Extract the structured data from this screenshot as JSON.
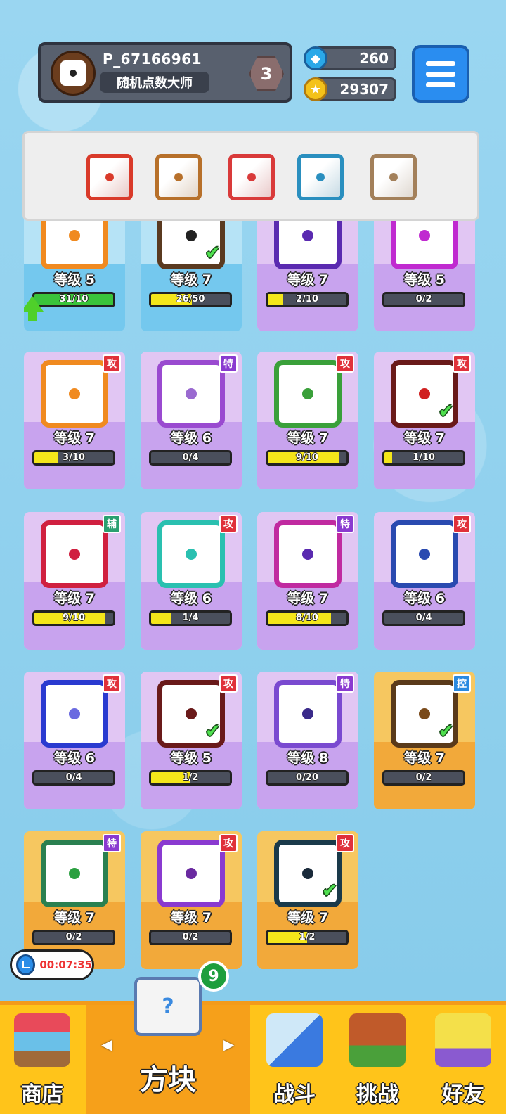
{
  "header": {
    "player_name": "P_67166961",
    "player_title": "随机点数大师",
    "rank": "3",
    "gems": "260",
    "gold": "29307"
  },
  "deck": {
    "slots": [
      {
        "name": "fire-dice-slot",
        "color": "#d93a2a"
      },
      {
        "name": "dragon-dice-slot",
        "color": "#b7702a"
      },
      {
        "name": "lightning-dice-slot",
        "color": "#d93a3a"
      },
      {
        "name": "vortex-dice-slot",
        "color": "#2a8fbf"
      },
      {
        "name": "mystery-dice-slot",
        "color": "#a3805a"
      }
    ]
  },
  "cards": [
    {
      "name": "card-sun",
      "theme": "blue",
      "border": "#f08a20",
      "pip": "#f08a20",
      "level": "等级 5",
      "progress": "31/10",
      "fill": 1.0,
      "fill_color": "green",
      "tag": "",
      "tag_color": "",
      "check": false,
      "upgrade": true
    },
    {
      "name": "card-mystery",
      "theme": "blue",
      "border": "#5a3a20",
      "pip": "#222222",
      "level": "等级 7",
      "progress": "26/50",
      "fill": 0.52,
      "fill_color": "yellow",
      "tag": "",
      "tag_color": "",
      "check": true,
      "upgrade": false
    },
    {
      "name": "card-sword",
      "theme": "purple",
      "border": "#5a2ab0",
      "pip": "#5a2ab0",
      "level": "等级 7",
      "progress": "2/10",
      "fill": 0.2,
      "fill_color": "yellow",
      "tag": "",
      "tag_color": "",
      "check": false,
      "upgrade": false
    },
    {
      "name": "card-pixel",
      "theme": "purple",
      "border": "#c02ad0",
      "pip": "#c02ad0",
      "level": "等级 5",
      "progress": "0/2",
      "fill": 0,
      "fill_color": "yellow",
      "tag": "",
      "tag_color": "",
      "check": false,
      "upgrade": false
    },
    {
      "name": "card-target",
      "theme": "purple",
      "border": "#f08a20",
      "pip": "#f08a20",
      "level": "等级 7",
      "progress": "3/10",
      "fill": 0.3,
      "fill_color": "yellow",
      "tag": "攻",
      "tag_color": "#e0313a",
      "check": false,
      "upgrade": false
    },
    {
      "name": "card-rainbow",
      "theme": "purple",
      "border": "#9a4ad0",
      "pip": "#9a6ad0",
      "level": "等级 6",
      "progress": "0/4",
      "fill": 0,
      "fill_color": "yellow",
      "tag": "特",
      "tag_color": "#8a3ad0",
      "check": false,
      "upgrade": false
    },
    {
      "name": "card-poison",
      "theme": "purple",
      "border": "#3aa03a",
      "pip": "#3aa03a",
      "level": "等级 7",
      "progress": "9/10",
      "fill": 0.9,
      "fill_color": "yellow",
      "tag": "攻",
      "tag_color": "#e0313a",
      "check": false,
      "upgrade": false
    },
    {
      "name": "card-thunder",
      "theme": "purple",
      "border": "#6a1a1a",
      "pip": "#d02020",
      "level": "等级 7",
      "progress": "1/10",
      "fill": 0.1,
      "fill_color": "yellow",
      "tag": "攻",
      "tag_color": "#e0313a",
      "check": true,
      "upgrade": false
    },
    {
      "name": "card-heal",
      "theme": "purple",
      "border": "#d02040",
      "pip": "#d02040",
      "level": "等级 7",
      "progress": "9/10",
      "fill": 0.9,
      "fill_color": "yellow",
      "tag": "辅",
      "tag_color": "#2aa070",
      "check": false,
      "upgrade": false
    },
    {
      "name": "card-wind",
      "theme": "purple",
      "border": "#2ac0b0",
      "pip": "#2ac0b0",
      "level": "等级 6",
      "progress": "1/4",
      "fill": 0.25,
      "fill_color": "yellow",
      "tag": "攻",
      "tag_color": "#e0313a",
      "check": false,
      "upgrade": false
    },
    {
      "name": "card-swap",
      "theme": "purple",
      "border": "#c02aa0",
      "pip": "#5a2ab0",
      "level": "等级 7",
      "progress": "8/10",
      "fill": 0.8,
      "fill_color": "yellow",
      "tag": "特",
      "tag_color": "#8a3ad0",
      "check": false,
      "upgrade": false
    },
    {
      "name": "card-gear",
      "theme": "purple",
      "border": "#2a4ab0",
      "pip": "#2a4ab0",
      "level": "等级 6",
      "progress": "0/4",
      "fill": 0,
      "fill_color": "yellow",
      "tag": "攻",
      "tag_color": "#e0313a",
      "check": false,
      "upgrade": false
    },
    {
      "name": "card-ice",
      "theme": "purple",
      "border": "#2a3ad0",
      "pip": "#6a6ae0",
      "level": "等级 6",
      "progress": "0/4",
      "fill": 0,
      "fill_color": "yellow",
      "tag": "攻",
      "tag_color": "#e0313a",
      "check": false,
      "upgrade": false
    },
    {
      "name": "card-fire",
      "theme": "purple",
      "border": "#6a1a1a",
      "pip": "#6a1a1a",
      "level": "等级 5",
      "progress": "1/2",
      "fill": 0.5,
      "fill_color": "yellow",
      "tag": "攻",
      "tag_color": "#e0313a",
      "check": true,
      "upgrade": false
    },
    {
      "name": "card-crack",
      "theme": "purple",
      "border": "#7a4ad0",
      "pip": "#3a2a8a",
      "level": "等级 8",
      "progress": "0/20",
      "fill": 0,
      "fill_color": "yellow",
      "tag": "特",
      "tag_color": "#8a3ad0",
      "check": false,
      "upgrade": false
    },
    {
      "name": "card-dragon-brown",
      "theme": "gold",
      "border": "#5a3a1a",
      "pip": "#7a4a1a",
      "level": "等级 7",
      "progress": "0/2",
      "fill": 0,
      "fill_color": "yellow",
      "tag": "控",
      "tag_color": "#2a8ae0",
      "check": true,
      "upgrade": false
    },
    {
      "name": "card-dragon-green",
      "theme": "gold",
      "border": "#2a8050",
      "pip": "#2aa040",
      "level": "等级 7",
      "progress": "0/2",
      "fill": 0,
      "fill_color": "yellow",
      "tag": "特",
      "tag_color": "#8a3ad0",
      "check": false,
      "upgrade": false
    },
    {
      "name": "card-dragon-purple",
      "theme": "gold",
      "border": "#8a3ad0",
      "pip": "#6a2aa0",
      "level": "等级 7",
      "progress": "0/2",
      "fill": 0,
      "fill_color": "yellow",
      "tag": "攻",
      "tag_color": "#e0313a",
      "check": false,
      "upgrade": false
    },
    {
      "name": "card-dragon-dark",
      "theme": "gold",
      "border": "#1a3a4a",
      "pip": "#1a2a3a",
      "level": "等级 7",
      "progress": "1/2",
      "fill": 0.5,
      "fill_color": "yellow",
      "tag": "攻",
      "tag_color": "#e0313a",
      "check": true,
      "upgrade": false
    }
  ],
  "timer": "00:07:35",
  "nav": {
    "shop": "商店",
    "dice": "方块",
    "dice_badge": "9",
    "battle": "战斗",
    "challenge": "挑战",
    "friends": "好友"
  }
}
